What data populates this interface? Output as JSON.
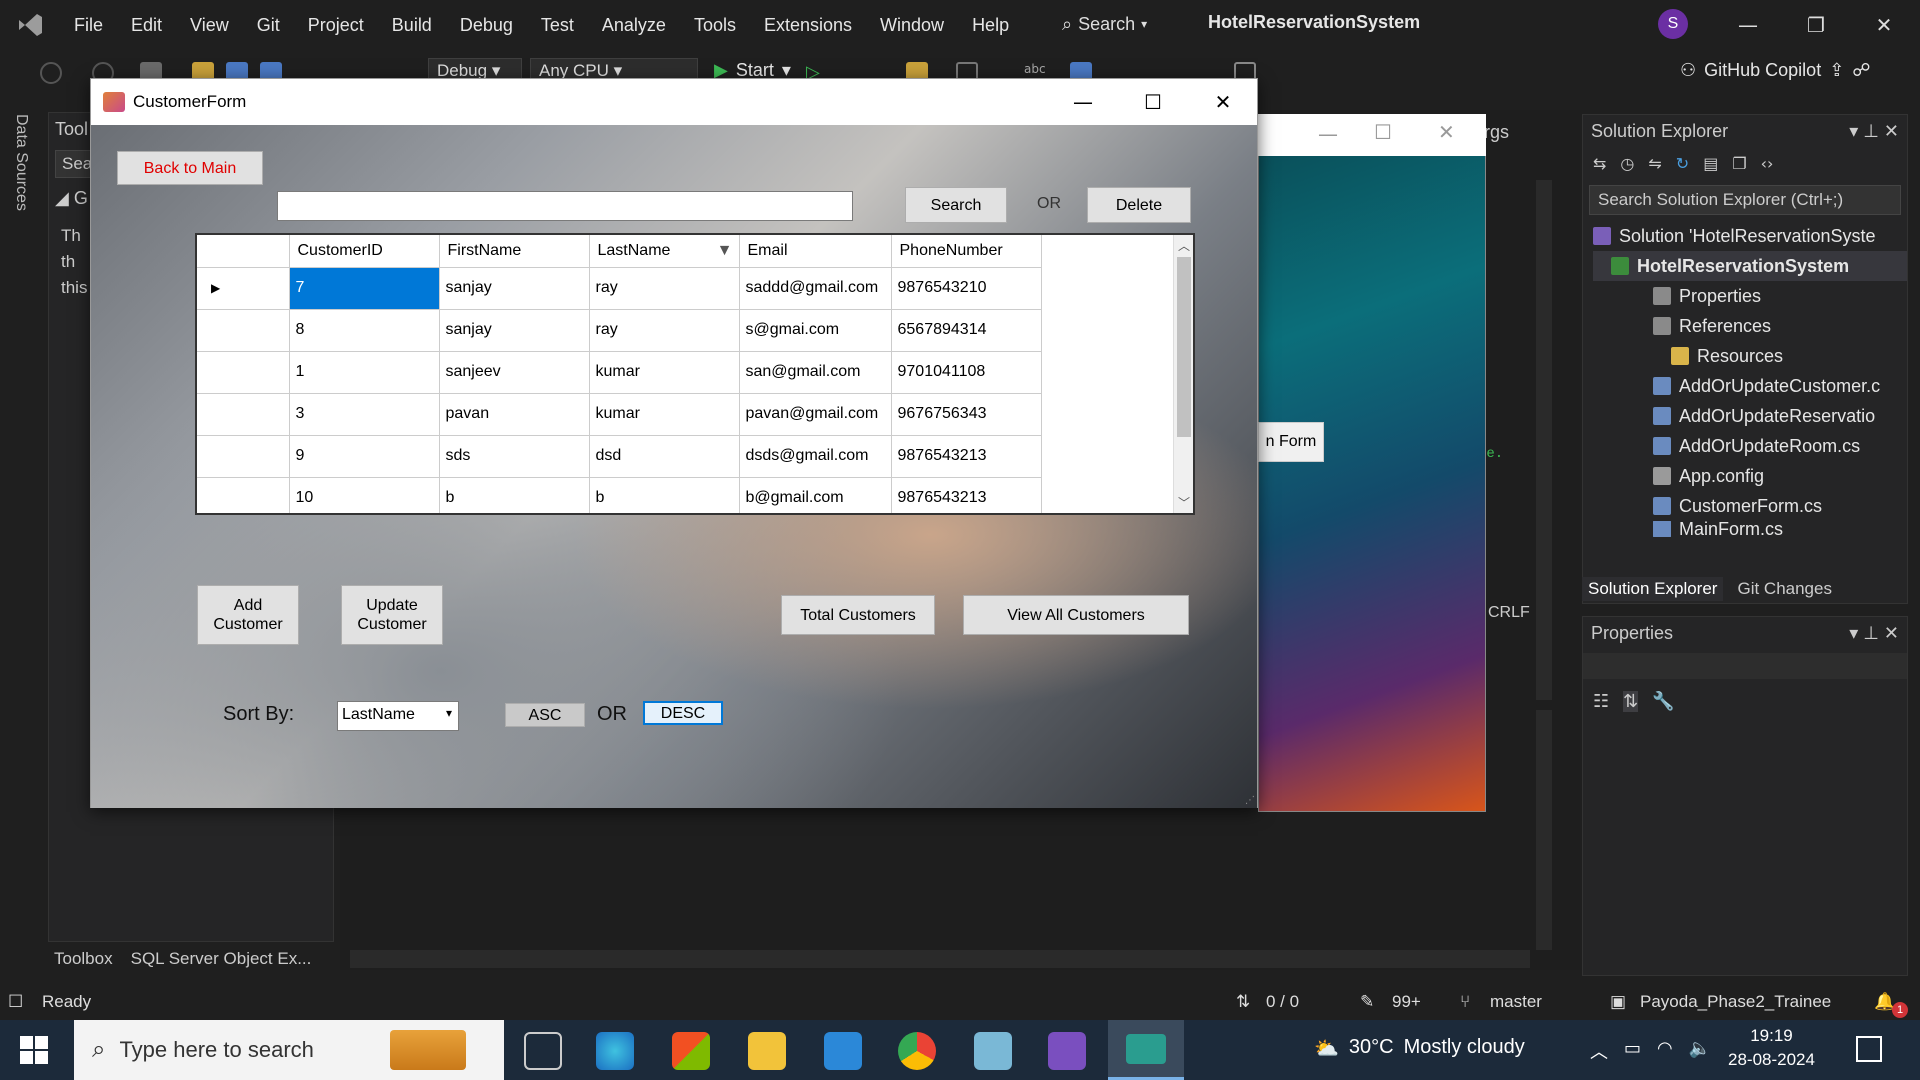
{
  "vs": {
    "menu": [
      "File",
      "Edit",
      "View",
      "Git",
      "Project",
      "Build",
      "Debug",
      "Test",
      "Analyze",
      "Tools",
      "Extensions",
      "Window",
      "Help"
    ],
    "search_label": "Search",
    "title": "HotelReservationSystem",
    "avatar_initial": "S",
    "toolbar": {
      "config": "Debug",
      "platform": "Any CPU",
      "start_label": "Start",
      "copilot_label": "GitHub Copilot"
    },
    "left_strip_label": "Data Sources",
    "toolbox_tabs": [
      "Toolbox",
      "SQL Server Object Ex..."
    ],
    "toolbox_header": "Tool",
    "toolbox_search": "Sea",
    "toolbox_text": [
      "Th",
      "th",
      "this"
    ]
  },
  "solution_explorer": {
    "title": "Solution Explorer",
    "search_placeholder": "Search Solution Explorer (Ctrl+;)",
    "items": [
      {
        "label": "Solution 'HotelReservationSyste",
        "icon": "solution-icon"
      },
      {
        "label": "HotelReservationSystem",
        "icon": "csharp-project-icon"
      },
      {
        "label": "Properties",
        "icon": "wrench-icon"
      },
      {
        "label": "References",
        "icon": "references-icon"
      },
      {
        "label": "Resources",
        "icon": "folder-icon"
      },
      {
        "label": "AddOrUpdateCustomer.c",
        "icon": "form-icon"
      },
      {
        "label": "AddOrUpdateReservatio",
        "icon": "form-icon"
      },
      {
        "label": "AddOrUpdateRoom.cs",
        "icon": "form-icon"
      },
      {
        "label": "App.config",
        "icon": "config-icon"
      },
      {
        "label": "CustomerForm.cs",
        "icon": "form-icon"
      },
      {
        "label": "MainForm.cs",
        "icon": "form-icon"
      }
    ],
    "tabs": [
      "Solution Explorer",
      "Git Changes"
    ]
  },
  "properties": {
    "title": "Properties"
  },
  "editor_misc": {
    "args_label": "rgs",
    "crlf": "CRLF",
    "bg_form_button": "n Form",
    "code_hint": "se."
  },
  "customer_form": {
    "title": "CustomerForm",
    "back_button": "Back to Main",
    "search_value": "",
    "search_button": "Search",
    "or_label": "OR",
    "delete_button": "Delete",
    "grid": {
      "columns": [
        "CustomerID",
        "FirstName",
        "LastName",
        "Email",
        "PhoneNumber"
      ],
      "rows": [
        [
          "7",
          "sanjay",
          "ray",
          "saddd@gmail.com",
          "9876543210"
        ],
        [
          "8",
          "sanjay",
          "ray",
          "s@gmai.com",
          "6567894314"
        ],
        [
          "1",
          "sanjeev",
          "kumar",
          "san@gmail.com",
          "9701041108"
        ],
        [
          "3",
          "pavan",
          "kumar",
          "pavan@gmail.com",
          "9676756343"
        ],
        [
          "9",
          "sds",
          "dsd",
          "dsds@gmail.com",
          "9876543213"
        ],
        [
          "10",
          "b",
          "b",
          "b@gmail.com",
          "9876543213"
        ]
      ]
    },
    "add_button": "Add Customer",
    "update_button": "Update Customer",
    "total_button": "Total Customers",
    "view_all_button": "View All Customers",
    "sort_label": "Sort By:",
    "sort_value": "LastName",
    "asc_button": "ASC",
    "or_label2": "OR",
    "desc_button": "DESC"
  },
  "status": {
    "ready": "Ready",
    "lines": "0 / 0",
    "edits": "99+",
    "branch": "master",
    "repo": "Payoda_Phase2_Trainee",
    "notifications": "1"
  },
  "taskbar": {
    "search_placeholder": "Type here to search",
    "weather": {
      "temp": "30°C",
      "desc": "Mostly cloudy"
    },
    "time": "19:19",
    "date": "28-08-2024"
  },
  "colors": {
    "accent": "#0078d7",
    "vs_purple": "#6b2fa3",
    "back_text": "#e00000"
  }
}
